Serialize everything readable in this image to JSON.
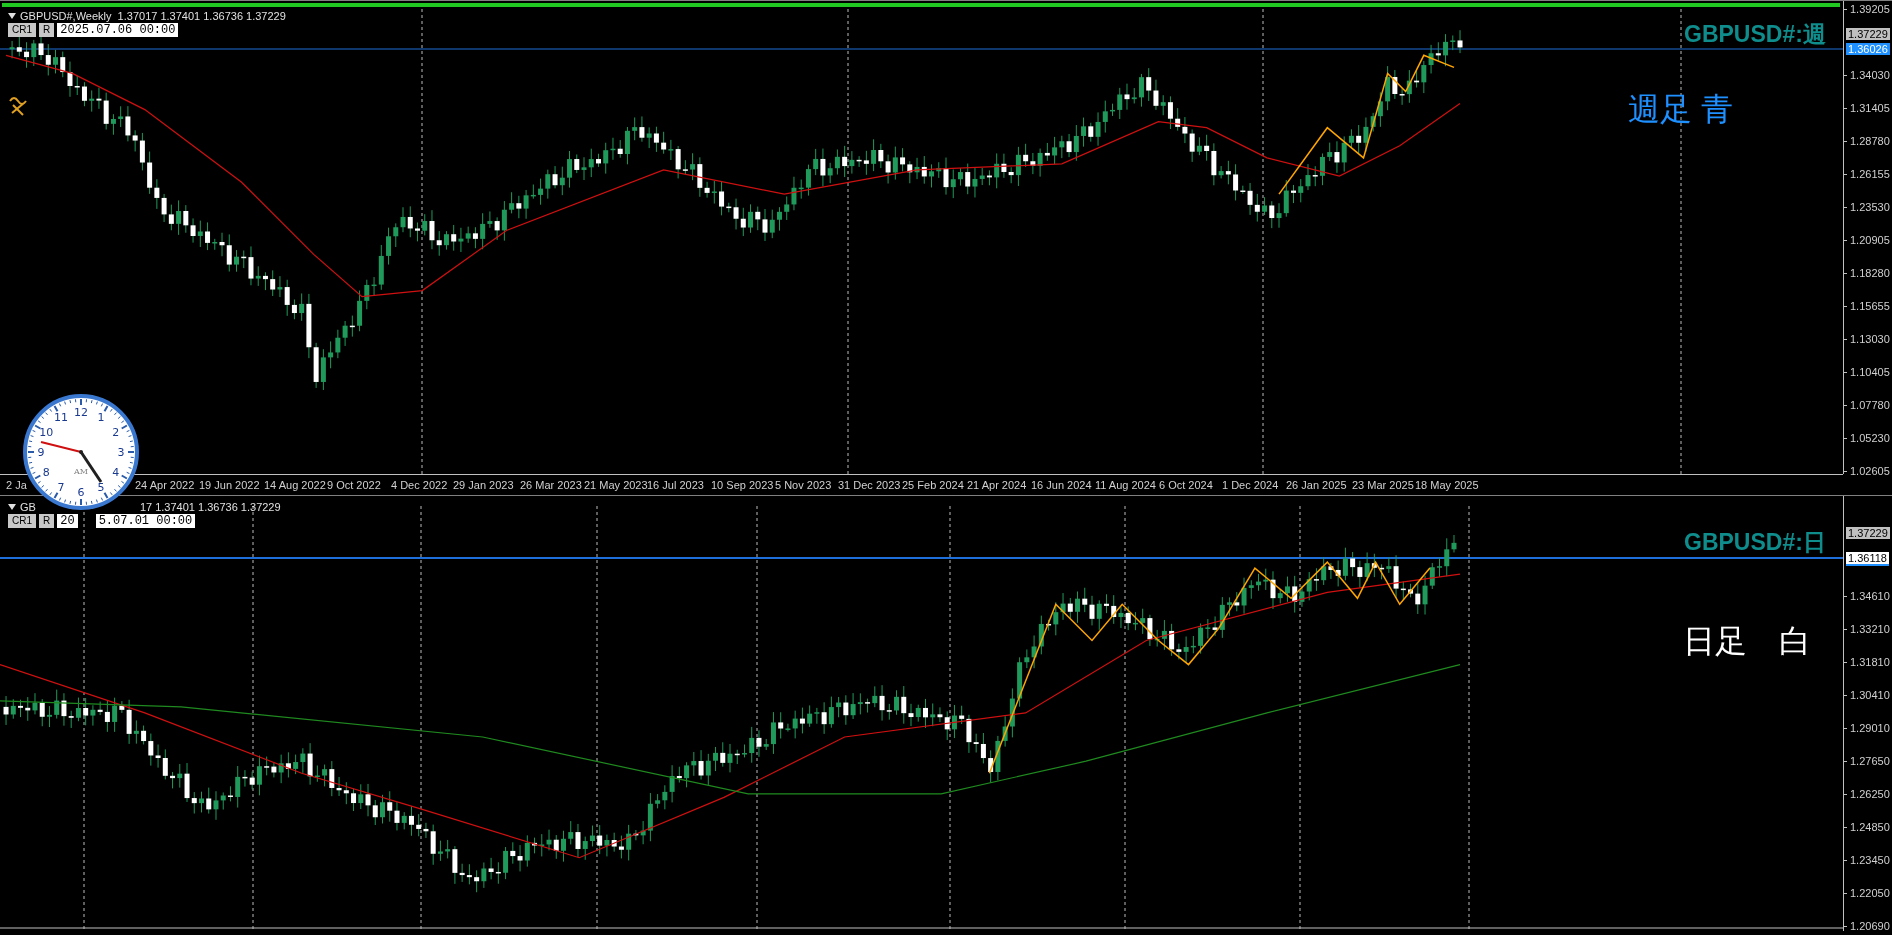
{
  "charts": [
    {
      "header_parts": [
        "GBPUSD#,Weekly  1.37017 1.37401 1.36736 1.37229"
      ],
      "buttons": [
        "CR1",
        "R"
      ],
      "date_parts": [
        "2025.07.06 00:00"
      ],
      "title": "GBPUSD#:週",
      "note": "週足 青",
      "color": "#1e90ff",
      "price_axis": [
        "1.39205",
        "1.34030",
        "1.31405",
        "1.28780",
        "1.26155",
        "1.23530",
        "1.20905",
        "1.18280",
        "1.15655",
        "1.13030",
        "1.10405",
        "1.07780",
        "1.05230",
        "1.02605"
      ],
      "price_tags": [
        {
          "text": "1.37229",
          "kind": "bid"
        },
        {
          "text": "1.36026",
          "kind": "line"
        }
      ],
      "time_axis": [
        "2 Ja",
        "24 Apr 2022",
        "19 Jun 2022",
        "14 Aug 2022",
        "9 Oct 2022",
        "4 Dec 2022",
        "29 Jan 2023",
        "26 Mar 2023",
        "21 May 2023",
        "16 Jul 2023",
        "10 Sep 2023",
        "5 Nov 2023",
        "31 Dec 2023",
        "25 Feb 2024",
        "21 Apr 2024",
        "16 Jun 2024",
        "11 Aug 2024",
        "6 Oct 2024",
        "1 Dec 2024",
        "26 Jan 2025",
        "23 Mar 2025",
        "18 May 2025"
      ]
    },
    {
      "header_parts": [
        "GB",
        "17 1.37401 1.36736 1.37229"
      ],
      "buttons": [
        "CR1",
        "R"
      ],
      "date_parts": [
        "20",
        "5.07.01 00:00"
      ],
      "title": "GBPUSD#:日",
      "note": "日足　白",
      "color": "#ffffff",
      "price_axis": [
        "1.34610",
        "1.33210",
        "1.31810",
        "1.30410",
        "1.29010",
        "1.27650",
        "1.26250",
        "1.24850",
        "1.23450",
        "1.22050",
        "1.20690"
      ],
      "price_tags": [
        {
          "text": "1.37229",
          "kind": "bid"
        },
        {
          "text": "1.36118",
          "kind": "selected_line"
        }
      ]
    }
  ],
  "clock": {
    "numbers": [
      "12",
      "11",
      "1",
      "10",
      "2",
      "9",
      "3",
      "8",
      "4",
      "7",
      "5",
      "6"
    ],
    "period": "AM"
  }
}
